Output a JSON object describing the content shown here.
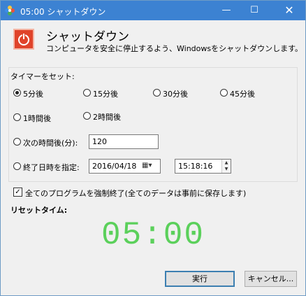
{
  "window": {
    "title": "05:00 シャットダウン",
    "minimize": "—",
    "maximize": "☐",
    "close": "✕"
  },
  "header": {
    "title": "シャットダウン",
    "description": "コンピュータを安全に停止するよう、Windowsをシャットダウンします。"
  },
  "timer_group": {
    "label": "タイマーをセット:",
    "options": [
      {
        "label": "5分後",
        "checked": true
      },
      {
        "label": "15分後",
        "checked": false
      },
      {
        "label": "30分後",
        "checked": false
      },
      {
        "label": "45分後",
        "checked": false
      },
      {
        "label": "1時間後",
        "checked": false
      },
      {
        "label": "2時間後",
        "checked": false
      }
    ],
    "after_minutes": {
      "label": "次の時間後(分):",
      "value": "120"
    },
    "specify_time": {
      "label": "終了日時を指定:",
      "date": "2016/04/18",
      "time": "15:18:16"
    }
  },
  "force_close": {
    "label": "全てのプログラムを強制終了(全てのデータは事前に保存します)",
    "checked": true
  },
  "reset_time": {
    "label": "リセットタイム:",
    "display": "05:00",
    "color": "#5bd05b"
  },
  "buttons": {
    "execute": "実行",
    "cancel": "キャンセル..."
  },
  "colors": {
    "titlebar": "#3c82d2",
    "header_icon": "#e0432a"
  }
}
